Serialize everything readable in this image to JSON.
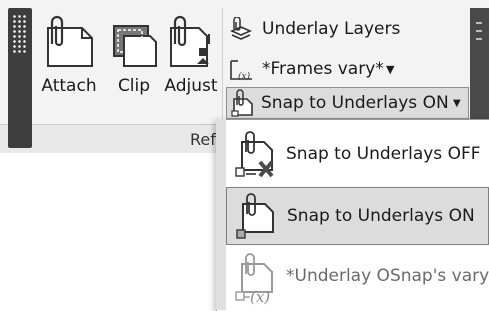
{
  "ribbon": {
    "buttons": {
      "attach": "Attach",
      "clip": "Clip",
      "adjust": "Adjust"
    },
    "underlay_layers": "Underlay Layers",
    "frames": "*Frames vary*",
    "snap_current": "Snap to Underlays ON",
    "section_label": "Refe"
  },
  "menu": {
    "items": [
      {
        "label": "Snap to Underlays OFF",
        "state": "normal"
      },
      {
        "label": "Snap to Underlays ON",
        "state": "selected"
      },
      {
        "label": "*Underlay OSnap's vary*",
        "state": "disabled"
      }
    ]
  },
  "colors": {
    "panel_bg": "#f3f3f3",
    "grip_dark": "#3d3d3d",
    "highlight": "#dcdcdc"
  }
}
